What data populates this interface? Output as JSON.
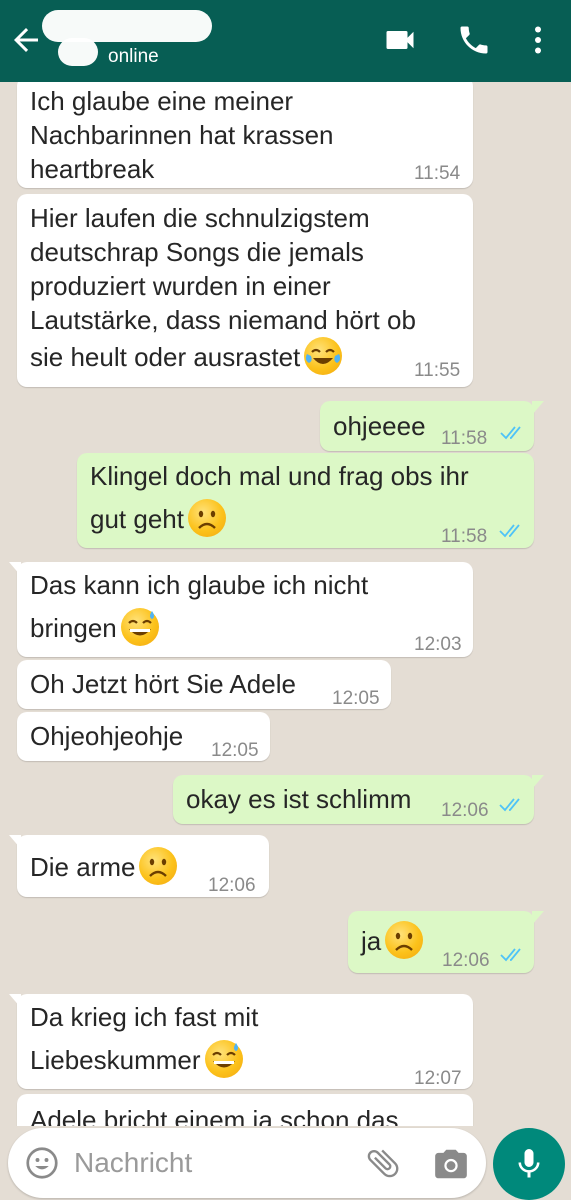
{
  "header": {
    "status": "online",
    "colors": {
      "bar": "#075e54"
    },
    "icons": [
      "back-arrow-icon",
      "video-call-icon",
      "phone-icon",
      "more-vert-icon"
    ]
  },
  "messages": [
    {
      "dir": "in",
      "text_lines": [
        "Ich glaube eine meiner",
        "Nachbarinnen hat krassen",
        "heartbreak"
      ],
      "time": "11:54",
      "emoji": ""
    },
    {
      "dir": "in",
      "text_lines": [
        "Hier laufen die schnulzigstem",
        "deutschrap Songs die jemals",
        "produziert wurden in einer",
        "Lautstärke, dass niemand hört ob",
        "sie heult oder ausrastet"
      ],
      "time": "11:55",
      "emoji": "face-with-tears-of-joy"
    },
    {
      "dir": "out",
      "text_lines": [
        "ohjeeee"
      ],
      "time": "11:58",
      "emoji": "",
      "read": true
    },
    {
      "dir": "out",
      "text_lines": [
        "Klingel doch mal und frag obs ihr",
        "gut geht"
      ],
      "time": "11:58",
      "emoji": "frowning-face",
      "read": true
    },
    {
      "dir": "in",
      "text_lines": [
        "Das kann ich glaube ich nicht",
        "bringen"
      ],
      "time": "12:03",
      "emoji": "grinning-face-with-sweat"
    },
    {
      "dir": "in",
      "text_lines": [
        "Oh Jetzt hört Sie Adele"
      ],
      "time": "12:05",
      "emoji": ""
    },
    {
      "dir": "in",
      "text_lines": [
        "Ohjeohjeohje"
      ],
      "time": "12:05",
      "emoji": ""
    },
    {
      "dir": "out",
      "text_lines": [
        "okay es ist schlimm"
      ],
      "time": "12:06",
      "emoji": "",
      "read": true
    },
    {
      "dir": "in",
      "text_lines": [
        "Die arme"
      ],
      "time": "12:06",
      "emoji": "frowning-face"
    },
    {
      "dir": "out",
      "text_lines": [
        "ja"
      ],
      "time": "12:06",
      "emoji": "frowning-face",
      "read": true
    },
    {
      "dir": "in",
      "text_lines": [
        "Da krieg ich fast mit",
        "Liebeskummer"
      ],
      "time": "12:07",
      "emoji": "grinning-face-with-sweat"
    },
    {
      "dir": "in",
      "text_lines": [
        "Adele bricht einem ja schon das"
      ],
      "time": "",
      "emoji": ""
    }
  ],
  "composer": {
    "placeholder": "Nachricht",
    "icons": [
      "emoji-icon",
      "attach-icon",
      "camera-icon",
      "mic-icon"
    ]
  },
  "colors": {
    "incoming_bubble": "#ffffff",
    "outgoing_bubble": "#dcf8c6",
    "read_ticks": "#4fc3f7",
    "chat_background": "#e4ddd4",
    "mic_button": "#00897b"
  }
}
